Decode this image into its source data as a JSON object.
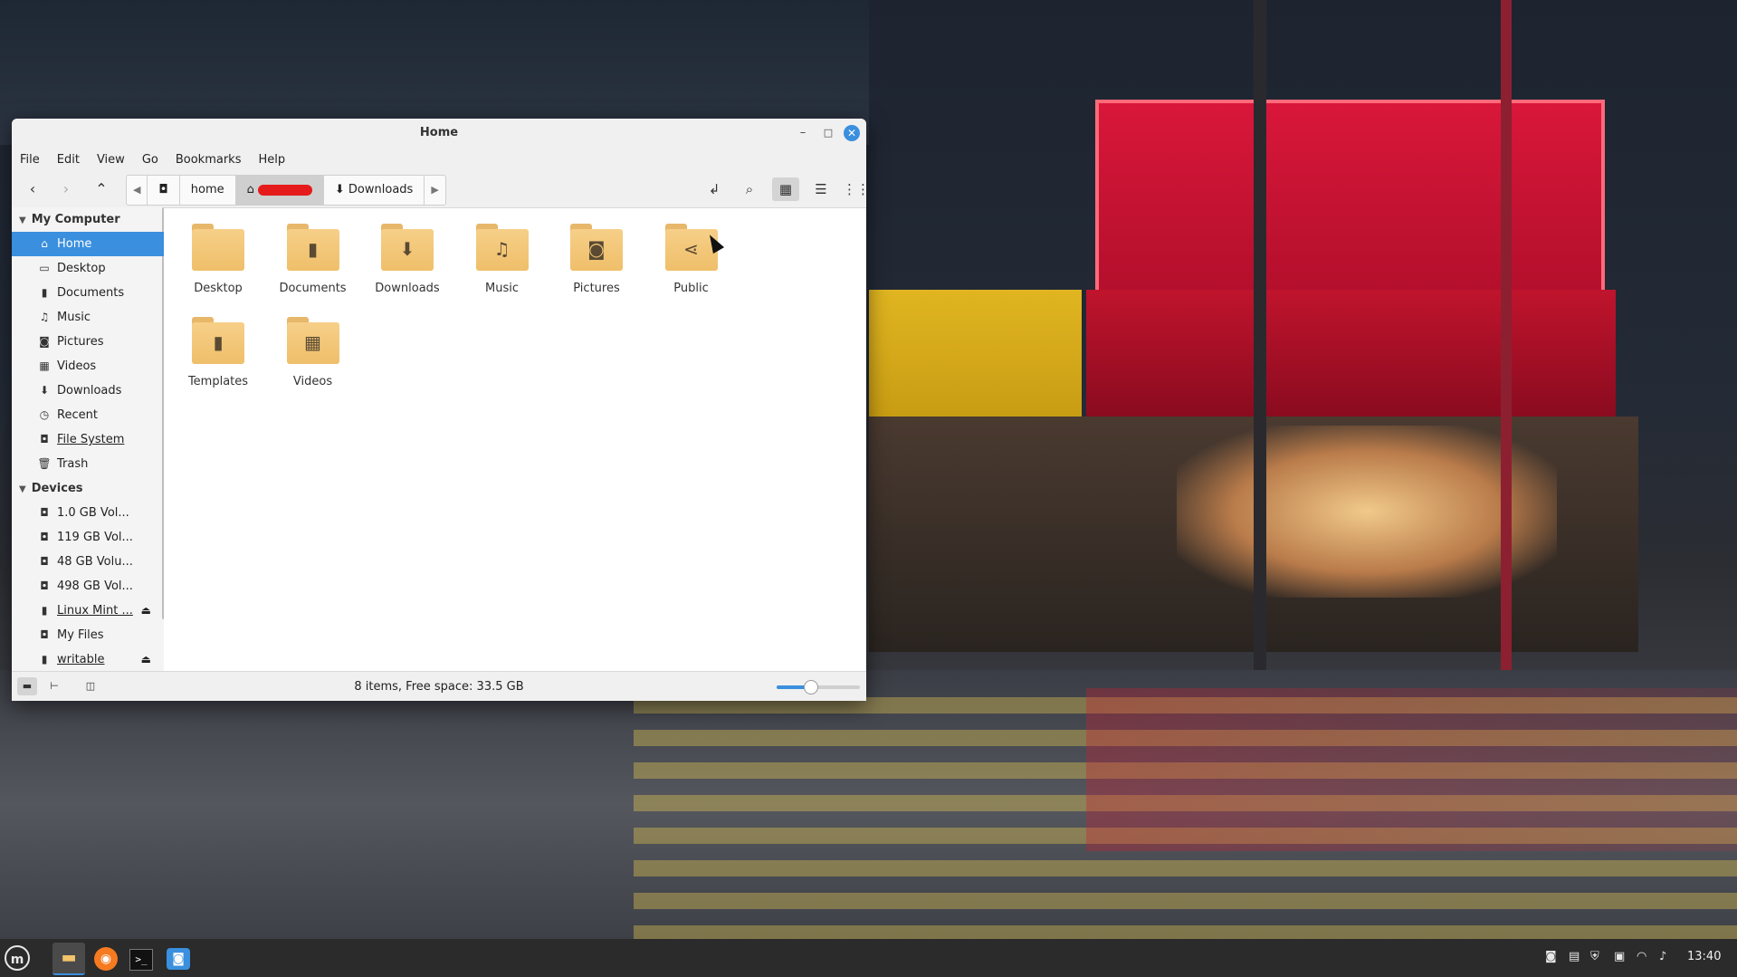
{
  "window": {
    "title": "Home",
    "minimize": "–",
    "maximize": "□",
    "close": "✕"
  },
  "menubar": [
    "File",
    "Edit",
    "View",
    "Go",
    "Bookmarks",
    "Help"
  ],
  "toolbar": {
    "path": {
      "left_arrow": "◀",
      "home_label": "home",
      "next_label": "Downloads",
      "right_arrow": "▶"
    }
  },
  "sidebar": {
    "sections": [
      {
        "title": "My Computer",
        "items": [
          {
            "label": "Home",
            "icon": "home-icon",
            "selected": true
          },
          {
            "label": "Desktop",
            "icon": "desktop-icon"
          },
          {
            "label": "Documents",
            "icon": "document-icon"
          },
          {
            "label": "Music",
            "icon": "music-icon"
          },
          {
            "label": "Pictures",
            "icon": "camera-icon"
          },
          {
            "label": "Videos",
            "icon": "film-icon"
          },
          {
            "label": "Downloads",
            "icon": "download-icon"
          },
          {
            "label": "Recent",
            "icon": "clock-icon"
          },
          {
            "label": "File System",
            "icon": "drive-icon",
            "underline": true
          },
          {
            "label": "Trash",
            "icon": "trash-icon"
          }
        ]
      },
      {
        "title": "Devices",
        "items": [
          {
            "label": "1.0 GB Vol...",
            "icon": "drive-icon"
          },
          {
            "label": "119 GB Vol...",
            "icon": "drive-icon"
          },
          {
            "label": "48 GB Volu...",
            "icon": "drive-icon"
          },
          {
            "label": "498 GB Vol...",
            "icon": "drive-icon"
          },
          {
            "label": "Linux Mint ...",
            "icon": "usb-icon",
            "underline": true,
            "eject": true
          },
          {
            "label": "My Files",
            "icon": "drive-icon"
          },
          {
            "label": "writable",
            "icon": "usb-icon",
            "underline": true,
            "eject": true
          }
        ]
      }
    ]
  },
  "files": [
    {
      "name": "Desktop",
      "icon": "folder-icon",
      "glyph": ""
    },
    {
      "name": "Documents",
      "icon": "folder-documents-icon",
      "glyph": "▮"
    },
    {
      "name": "Downloads",
      "icon": "folder-download-icon",
      "glyph": "⬇"
    },
    {
      "name": "Music",
      "icon": "folder-music-icon",
      "glyph": "♫"
    },
    {
      "name": "Pictures",
      "icon": "folder-pictures-icon",
      "glyph": "◙"
    },
    {
      "name": "Public",
      "icon": "folder-share-icon",
      "glyph": "⋖"
    },
    {
      "name": "Templates",
      "icon": "folder-templates-icon",
      "glyph": "▮"
    },
    {
      "name": "Videos",
      "icon": "folder-videos-icon",
      "glyph": "▦"
    }
  ],
  "status": {
    "text": "8 items, Free space: 33.5 GB",
    "zoom_level": 0.4
  },
  "taskbar": {
    "clock": "13:40",
    "menu_icon": "m"
  },
  "colors": {
    "accent": "#3a8fde",
    "folder": "#f6cf88",
    "taskbar": "#2b2b2b"
  }
}
